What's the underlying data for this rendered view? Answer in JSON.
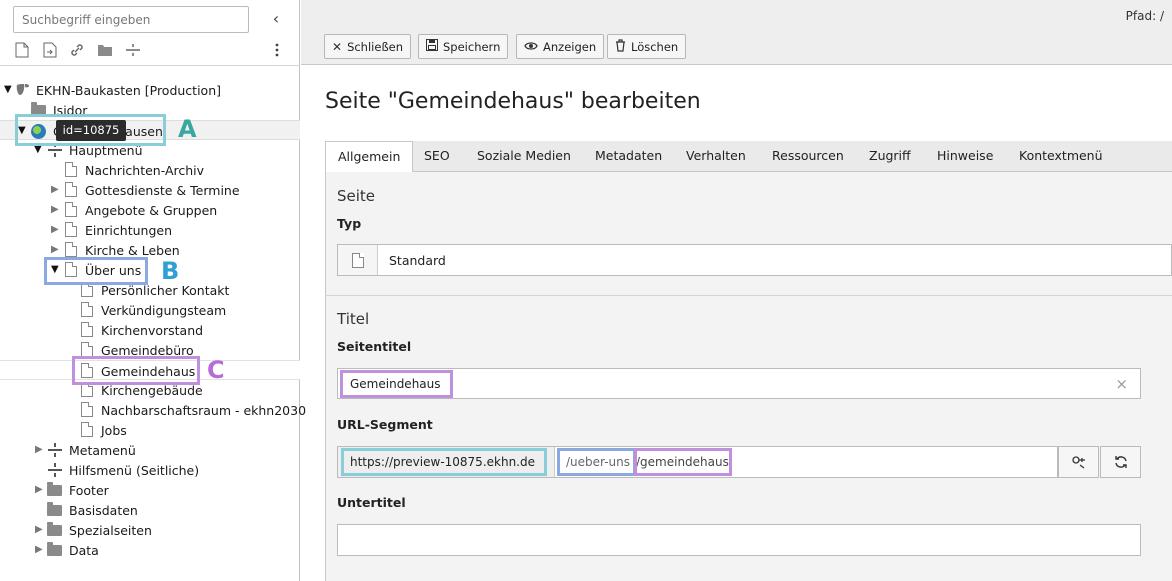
{
  "sidebar": {
    "search_placeholder": "Suchbegriff eingeben",
    "collapse_icon": "chevron-left-icon",
    "toolbar_icons": [
      "new-page-icon",
      "new-page-after-icon",
      "link-icon",
      "folder-icon",
      "separator-icon",
      "more-icon"
    ],
    "tree": [
      {
        "label": "EKHN-Baukasten [Production]",
        "icon": "typo3-logo-icon",
        "toggle": "expanded"
      },
      {
        "label": "Isidor",
        "icon": "folder-icon",
        "toggle": ""
      },
      {
        "label": "Gemeindehausen",
        "icon": "globe-icon",
        "toggle": "expanded"
      },
      {
        "label": "Hauptmenü",
        "icon": "separator-icon",
        "toggle": "expanded"
      },
      {
        "label": "Nachrichten-Archiv",
        "icon": "page-icon",
        "toggle": ""
      },
      {
        "label": "Gottesdienste & Termine",
        "icon": "page-icon",
        "toggle": "collapsed"
      },
      {
        "label": "Angebote & Gruppen",
        "icon": "page-icon",
        "toggle": "collapsed"
      },
      {
        "label": "Einrichtungen",
        "icon": "page-icon",
        "toggle": "collapsed"
      },
      {
        "label": "Kirche & Leben",
        "icon": "page-icon",
        "toggle": "collapsed"
      },
      {
        "label": "Über uns",
        "icon": "page-icon",
        "toggle": "expanded"
      },
      {
        "label": "Persönlicher Kontakt",
        "icon": "page-icon",
        "toggle": ""
      },
      {
        "label": "Verkündigungsteam",
        "icon": "page-icon",
        "toggle": ""
      },
      {
        "label": "Kirchenvorstand",
        "icon": "page-icon",
        "toggle": ""
      },
      {
        "label": "Gemeindebüro",
        "icon": "page-icon",
        "toggle": ""
      },
      {
        "label": "Gemeindehaus",
        "icon": "page-icon",
        "toggle": ""
      },
      {
        "label": "Kirchengebäude",
        "icon": "page-icon",
        "toggle": ""
      },
      {
        "label": "Nachbarschaftsraum - ekhn2030",
        "icon": "page-icon",
        "toggle": ""
      },
      {
        "label": "Jobs",
        "icon": "page-icon",
        "toggle": ""
      },
      {
        "label": "Metamenü",
        "icon": "separator-icon",
        "toggle": "collapsed"
      },
      {
        "label": "Hilfsmenü (Seitliche)",
        "icon": "separator-icon",
        "toggle": ""
      },
      {
        "label": "Footer",
        "icon": "folder-icon",
        "toggle": "collapsed"
      },
      {
        "label": "Basisdaten",
        "icon": "folder-icon",
        "toggle": ""
      },
      {
        "label": "Spezialseiten",
        "icon": "folder-icon",
        "toggle": "collapsed"
      },
      {
        "label": "Data",
        "icon": "folder-icon",
        "toggle": "collapsed"
      }
    ],
    "tooltip": "id=10875"
  },
  "annotations": {
    "a": "A",
    "b": "B",
    "c": "C",
    "colors": {
      "a": "#89cdd8",
      "b": "#8aa9e0",
      "c": "#c08fdd",
      "a_text": "#3aa7a0",
      "b_text": "#2f9fd6",
      "c_text": "#b86ad8"
    }
  },
  "header": {
    "path": "Pfad: /",
    "buttons": [
      {
        "label": "Schließen",
        "icon": "close-icon"
      },
      {
        "label": "Speichern",
        "icon": "save-icon"
      },
      {
        "label": "Anzeigen",
        "icon": "eye-icon"
      },
      {
        "label": "Löschen",
        "icon": "trash-icon"
      }
    ]
  },
  "main": {
    "title": "Seite \"Gemeindehaus\" bearbeiten",
    "tabs": [
      "Allgemein",
      "SEO",
      "Soziale Medien",
      "Metadaten",
      "Verhalten",
      "Ressourcen",
      "Zugriff",
      "Hinweise",
      "Kontextmenü"
    ],
    "active_tab": "Allgemein",
    "section_page": "Seite",
    "type_label": "Typ",
    "type_value": "Standard",
    "section_title": "Titel",
    "pagetitle_label": "Seitentitel",
    "pagetitle_value": "Gemeindehaus",
    "clear_icon": "×",
    "slug_label": "URL-Segment",
    "slug_prefix": "https://preview-10875.ekhn.de",
    "slug_parent": "/ueber-uns",
    "slug_self": "/gemeindehaus",
    "subtitle_label": "Untertitel",
    "subtitle_value": ""
  }
}
